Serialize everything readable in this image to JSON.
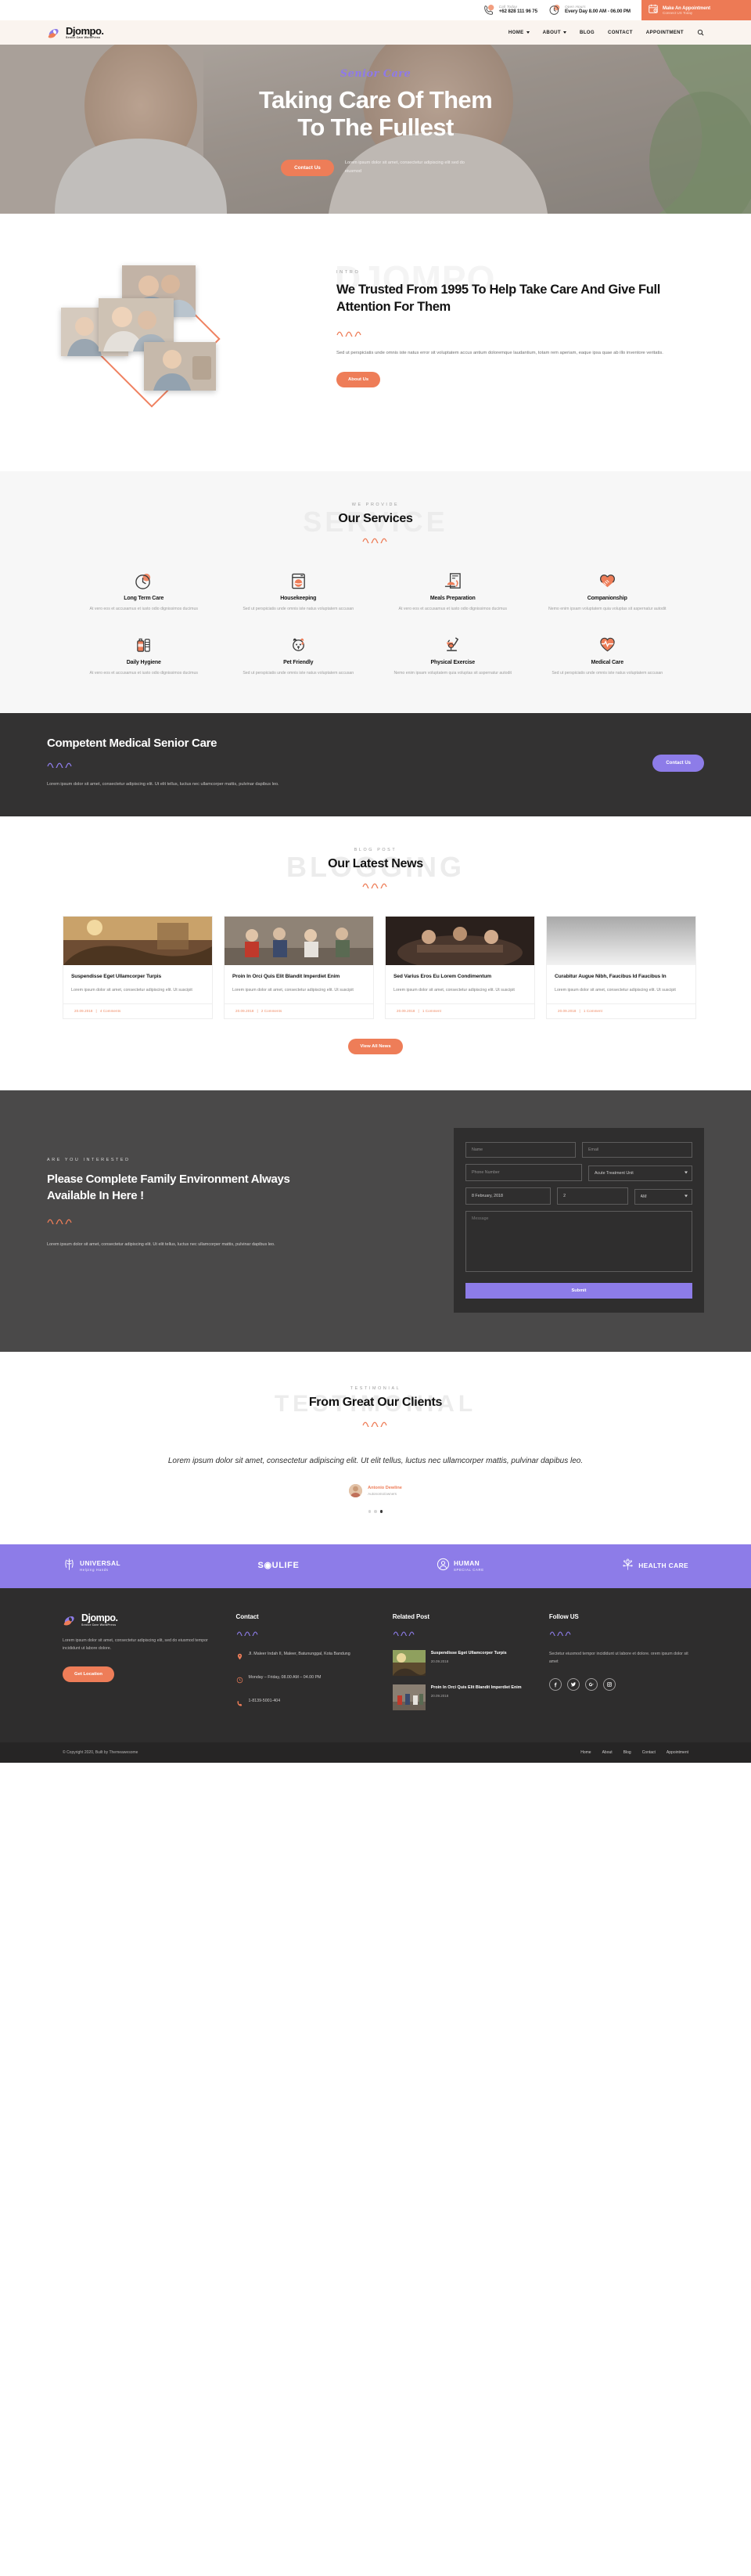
{
  "topbar": {
    "call_label": "Call Today",
    "call_value": "+62 828 111 96 75",
    "hours_label": "Open Hours",
    "hours_value": "Every Day 8.00 AM - 06.00 PM",
    "appointment_title": "Make An Appointment",
    "appointment_sub": "Connect US Today"
  },
  "brand": {
    "name": "Djompo.",
    "tagline": "Senior Care WordPress"
  },
  "nav": {
    "items": [
      {
        "label": "HOME",
        "has_dropdown": true
      },
      {
        "label": "ABOUT",
        "has_dropdown": true
      },
      {
        "label": "BLOG",
        "has_dropdown": false
      },
      {
        "label": "CONTACT",
        "has_dropdown": false
      },
      {
        "label": "APPOINTMENT",
        "has_dropdown": false
      }
    ],
    "search_icon": "search-icon"
  },
  "hero": {
    "script": "Senior Care",
    "title_line1": "Taking Care Of Them",
    "title_line2": "To The Fullest",
    "button": "Contact Us",
    "paragraph": "Lorem ipsum dolor sit amet, consectetur adipiscing elit sed do eiusmod"
  },
  "intro": {
    "watermark": "DJOMPO",
    "eyebrow": "INTRO",
    "title": "We Trusted From 1995 To Help Take Care And Give Full Attention For Them",
    "paragraph": "Sed ut perspiciatis unde omnis iste natus error sit voluptatem accus antium doloremque laudantium, totam rem aperiam, eaque ipsa quae ab illo inventore veritatis.",
    "button": "About Us"
  },
  "services": {
    "watermark": "SERVICE",
    "eyebrow": "WE PROVIDE",
    "title": "Our Services",
    "items": [
      {
        "icon": "clock-icon",
        "title": "Long Term Care",
        "desc": "At vero eos et accusamus et iusto odio dignissimos ducimus"
      },
      {
        "icon": "washing-machine-icon",
        "title": "Housekeeping",
        "desc": "Sed ut perspiciatis unde omnis iste natus voluptatem accusan"
      },
      {
        "icon": "meal-icon",
        "title": "Meals Preparation",
        "desc": "At vero eos et accusamus et iusto odio dignissimos ducimus"
      },
      {
        "icon": "handshake-icon",
        "title": "Companionship",
        "desc": "Nemo enim ipsam voluptatem quia voluptas sit aspernatur autodit"
      },
      {
        "icon": "soap-bottle-icon",
        "title": "Daily Hygiene",
        "desc": "At vero eos et accusamus et iusto odio dignissimos ducimus"
      },
      {
        "icon": "dog-icon",
        "title": "Pet Friendly",
        "desc": "Sed ut perspiciatis unde omnis iste natus voluptatem accusan"
      },
      {
        "icon": "exercise-bike-icon",
        "title": "Physical Exercise",
        "desc": "Nemo enim ipsam voluptatem quia voluptas sit aspernatur autodit"
      },
      {
        "icon": "heartbeat-icon",
        "title": "Medical Care",
        "desc": "Sed ut perspiciatis unde omnis iste natus voluptatem accusan"
      }
    ]
  },
  "dark_cta": {
    "title": "Competent Medical Senior Care",
    "paragraph": "Lorem ipsum dolor sit amet, consectetur adipiscing elit. Ut elit tellus, luctus nec ullamcorper mattis, pulvinar dapibus leo.",
    "button": "Contact Us"
  },
  "blog": {
    "watermark": "BLOGGING",
    "eyebrow": "BLOG POST",
    "title": "Our Latest News",
    "posts": [
      {
        "title": "Suspendisse Eget Ullamcorper Turpis",
        "excerpt": "Lorem ipsum dolor sit amet, consectetur adipiscing elit. Ut suscipit",
        "date": "20.09.2018",
        "comments": "4 Comments"
      },
      {
        "title": "Proin In Orci Quis Elit Blandit Imperdiet Enim",
        "excerpt": "Lorem ipsum dolor sit amet, consectetur adipiscing elit. Ut suscipit",
        "date": "20.09.2018",
        "comments": "2 Comments"
      },
      {
        "title": "Sed Varius Eros Eu Lorem Condimentum",
        "excerpt": "Lorem ipsum dolor sit amet, consectetur adipiscing elit. Ut suscipit",
        "date": "20.09.2018",
        "comments": "1 Comment"
      },
      {
        "title": "Curabitur Augue Nibh, Faucibus Id Faucibus In",
        "excerpt": "Lorem ipsum dolor sit amet, consectetur adipiscing elit. Ut suscipit",
        "date": "20.09.2018",
        "comments": "1 Comment"
      }
    ],
    "more_button": "View All News"
  },
  "appointment": {
    "eyebrow": "ARE YOU INTERESTED",
    "title": "Please Complete Family Environment Always Available In Here !",
    "paragraph": "Lorem ipsum dolor sit amet, consectetur adipiscing elit. Ut elit tellus, luctus nec ullamcorper mattis, pulvinar dapibus leo.",
    "form": {
      "name_placeholder": "Name",
      "email_placeholder": "Email",
      "phone_placeholder": "Phone Number",
      "unit_value": "Acute Treatment Unit",
      "date_value": "8 February, 2018",
      "hour_value": "2",
      "meridiem_value": "AM",
      "message_placeholder": "Message",
      "submit_label": "Submit"
    }
  },
  "testimonial": {
    "watermark": "TESTIMONIAL",
    "eyebrow": "TESTIMONIAL",
    "title": "From Great Our Clients",
    "quote": "Lorem ipsum dolor sit amet, consectetur adipiscing elit. Ut elit tellus, luctus nec ullamcorper mattis, pulvinar dapibus leo.",
    "author_name": "Antonio Dewline",
    "author_role": "Autonomo/owners",
    "active_dot": 3
  },
  "brands": [
    {
      "main": "UNIVERSAL",
      "sub": "Helping Hands",
      "icon": "caduceus-icon"
    },
    {
      "main": "S◉ULIFE",
      "sub": "",
      "icon": "soulife-icon"
    },
    {
      "main": "HUMAN",
      "sub": "SPECIAL CARE",
      "icon": "person-circle-icon"
    },
    {
      "main": "HEALTH CARE",
      "sub": "",
      "icon": "tree-icon"
    }
  ],
  "footer": {
    "about_text": "Lorem ipsum dolor sit amet, consectetur adipiscing elit, sed do eiusmod tempor incididunt ut labore dolore.",
    "location_button": "Get Location",
    "contact_heading": "Contact",
    "address": "Jl. Maleer Indah II, Maleer, Batununggal, Kota Bandung",
    "hours": "Monday – Friday, 08.00 AM – 04.00 PM",
    "phone": "1-8139-5001-404",
    "related_heading": "Related Post",
    "related": [
      {
        "title": "Suspendisse Eget Ullamcorper Turpis",
        "date": "20.09.2018"
      },
      {
        "title": "Proin In Orci Quis Elit Blandit Imperdiet Enim",
        "date": "20.09.2018"
      }
    ],
    "follow_heading": "Follow US",
    "follow_text": "Sectetur eiusmod tempor incididunt ut labore et dolore. orem ipsum dolor sit amet",
    "socials": [
      "facebook-icon",
      "twitter-icon",
      "google-plus-icon",
      "instagram-icon"
    ]
  },
  "copyright": {
    "text": "© Copyright 2020, Built by Themeawesome",
    "links": [
      "Home",
      "About",
      "Blog",
      "Contact",
      "Appointment"
    ]
  },
  "colors": {
    "accent": "#ee7d58",
    "purple": "#8d7ce8",
    "dark": "#333232",
    "cream": "#faf4ef"
  }
}
